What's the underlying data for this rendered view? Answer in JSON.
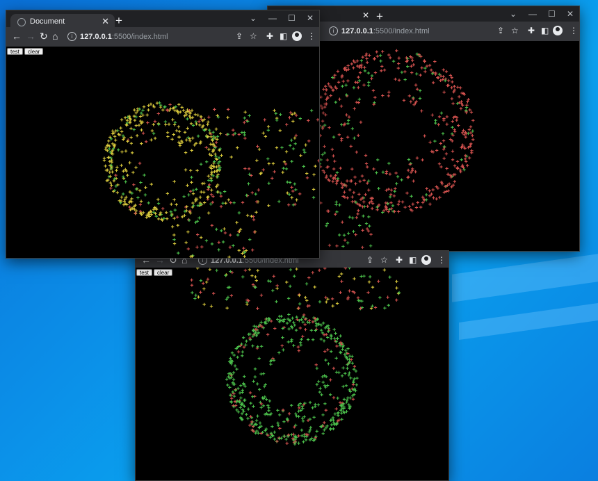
{
  "colors": {
    "yellow": "#d8c83c",
    "red": "#d4524f",
    "green": "#4bbf4b",
    "titlebar": "#202124",
    "toolbar": "#35363a"
  },
  "windows": {
    "w1": {
      "tab_title": "Document",
      "url_host": "127.0.0.1",
      "url_rest": ":5500/index.html",
      "buttons": {
        "test": "test",
        "clear": "clear"
      }
    },
    "w2": {
      "url_host": "127.0.0.1",
      "url_rest": ":5500/index.html"
    },
    "w3": {
      "url_host": "127.0.0.1",
      "url_rest": ":5500/index.html",
      "buttons": {
        "test": "test",
        "clear": "clear"
      }
    }
  },
  "icons": {
    "close": "✕",
    "new_tab": "+",
    "back": "←",
    "forward": "→",
    "reload": "↻",
    "home": "⌂",
    "share": "⇪",
    "star": "☆",
    "extensions": "✚",
    "sidepanel": "◧",
    "menu": "⋮",
    "minimize": "—",
    "maximize": "☐",
    "chevron": "⌄",
    "info": "i"
  }
}
